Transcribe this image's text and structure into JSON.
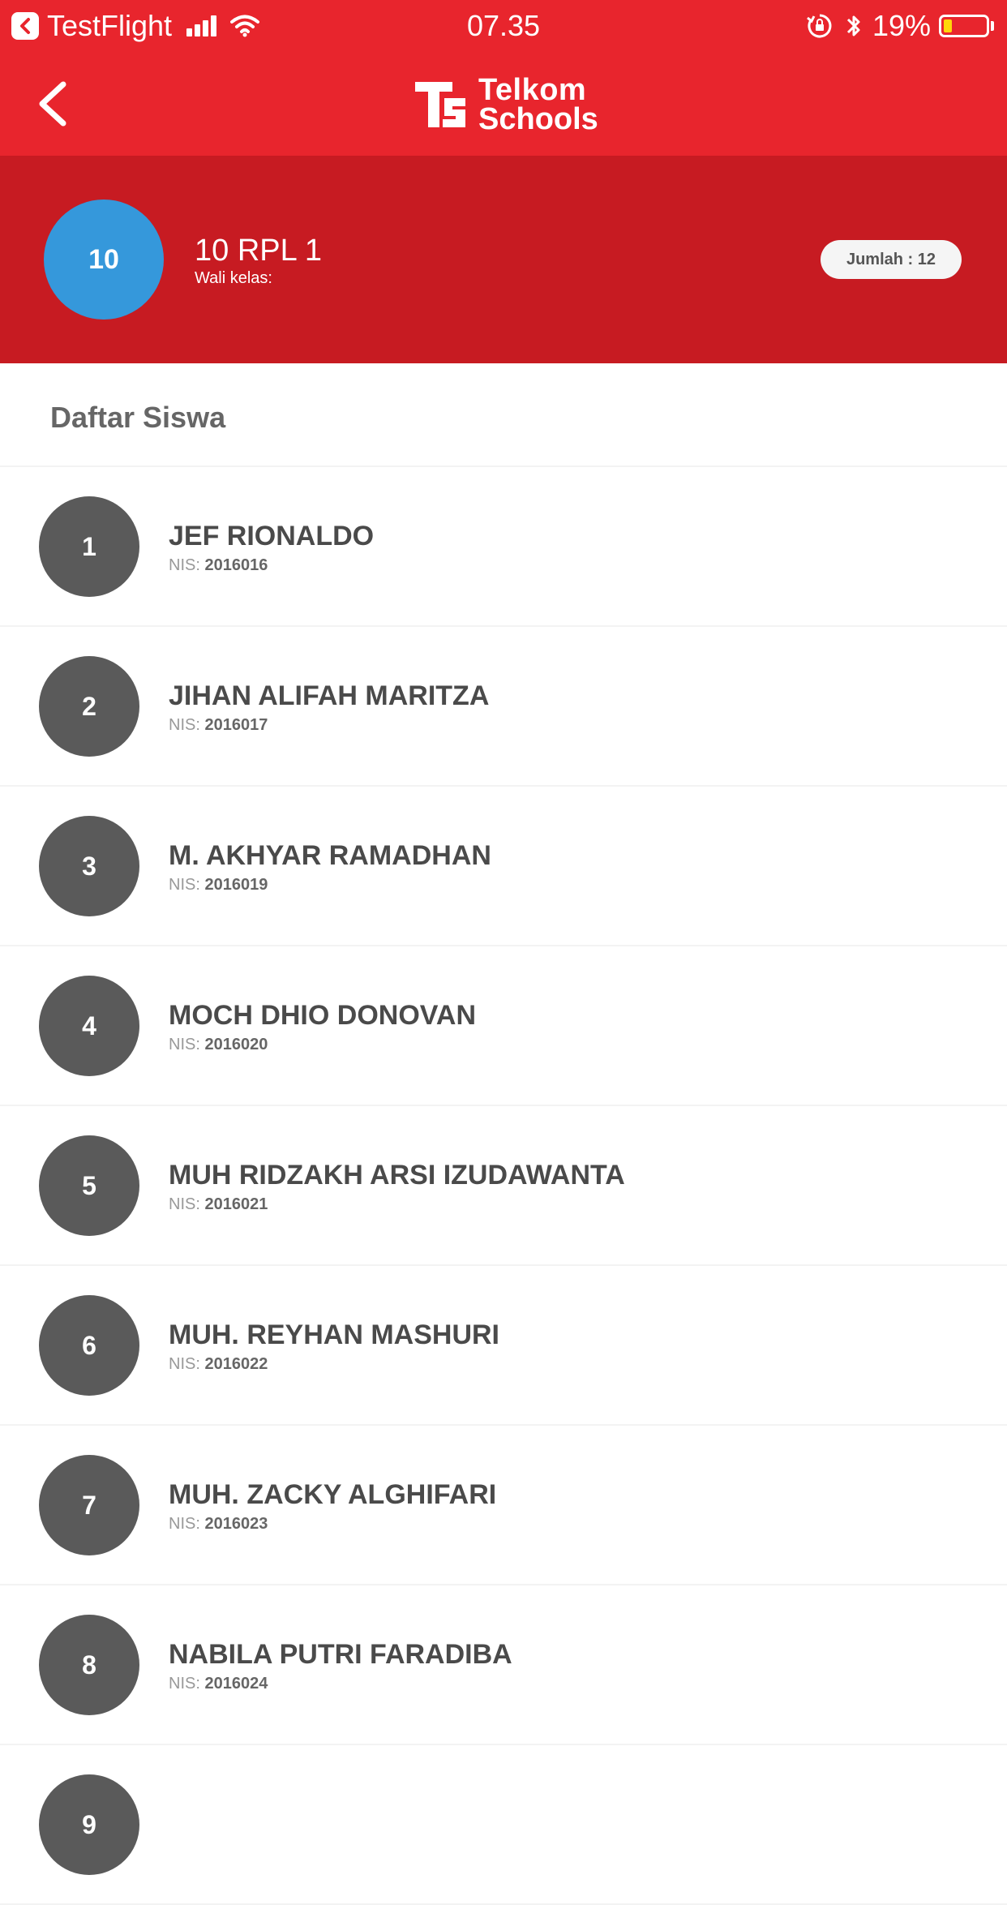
{
  "status_bar": {
    "app": "TestFlight",
    "time": "07.35",
    "battery": "19%",
    "battery_level": 0.19
  },
  "header": {
    "logo_line1": "Telkom",
    "logo_line2": "Schools"
  },
  "class_info": {
    "avatar": "10",
    "name": "10 RPL 1",
    "wali_label": "Wali kelas:",
    "jumlah": "Jumlah : 12"
  },
  "section_title": "Daftar Siswa",
  "nis_label": "NIS:",
  "students": [
    {
      "no": "1",
      "name": "JEF RIONALDO",
      "nis": "2016016"
    },
    {
      "no": "2",
      "name": "JIHAN ALIFAH MARITZA",
      "nis": "2016017"
    },
    {
      "no": "3",
      "name": "M. AKHYAR RAMADHAN",
      "nis": "2016019"
    },
    {
      "no": "4",
      "name": "MOCH DHIO DONOVAN",
      "nis": "2016020"
    },
    {
      "no": "5",
      "name": "MUH RIDZAKH ARSI IZUDAWANTA",
      "nis": "2016021"
    },
    {
      "no": "6",
      "name": "MUH. REYHAN MASHURI",
      "nis": "2016022"
    },
    {
      "no": "7",
      "name": "MUH. ZACKY ALGHIFARI",
      "nis": "2016023"
    },
    {
      "no": "8",
      "name": "NABILA PUTRI FARADIBA",
      "nis": "2016024"
    },
    {
      "no": "9",
      "name": "",
      "nis": ""
    }
  ],
  "colors": {
    "brand_red": "#e8252d",
    "header_red": "#c71b22",
    "class_avatar": "#3598db",
    "student_circle": "#5a5a5a"
  }
}
